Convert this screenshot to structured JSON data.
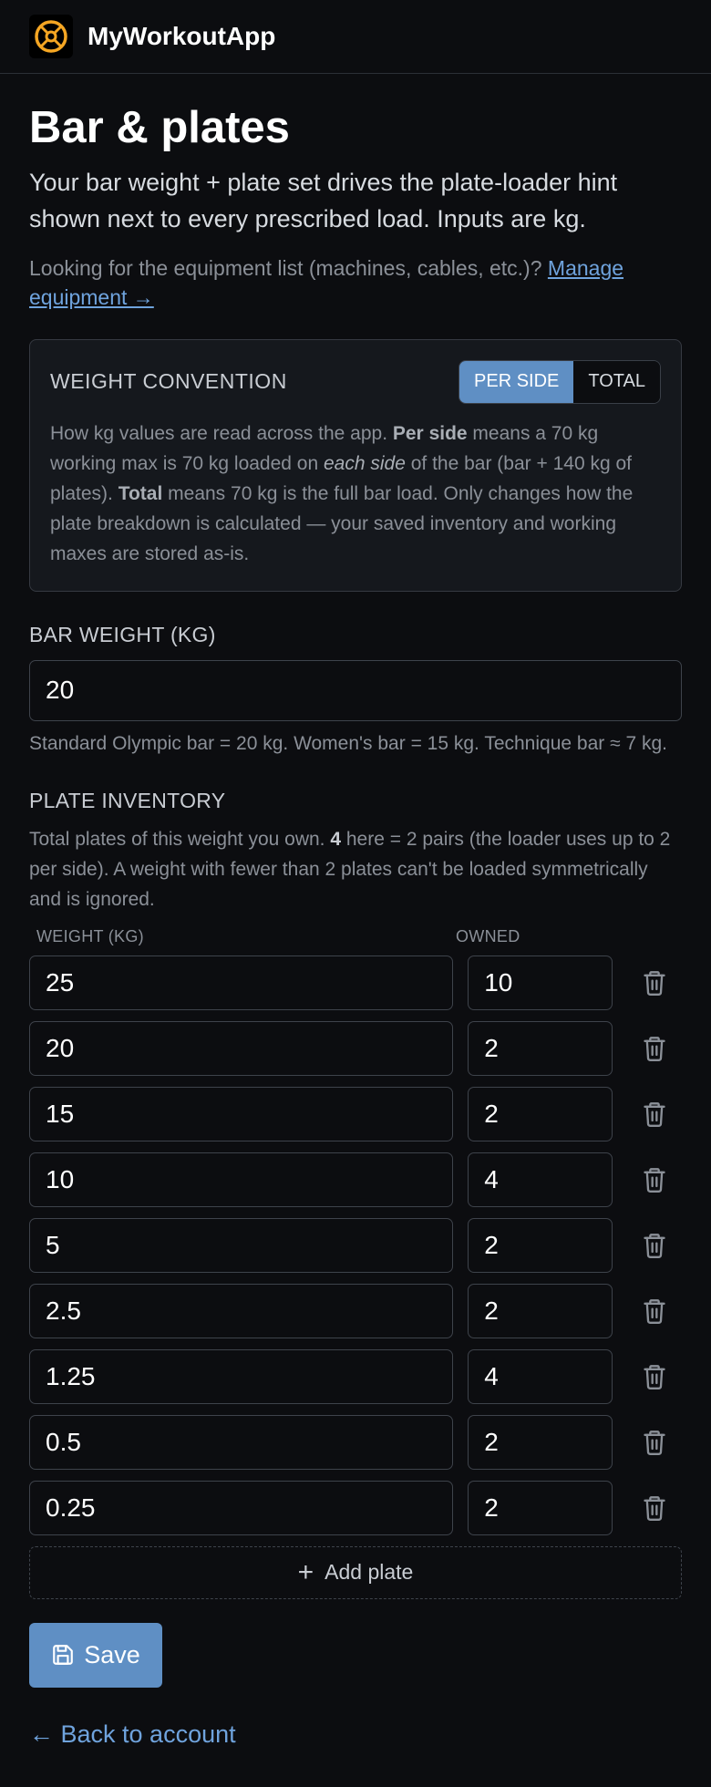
{
  "app": {
    "name": "MyWorkoutApp",
    "logo_icon": "plate-logo-icon",
    "accent": "#f5a623"
  },
  "page": {
    "title": "Bar & plates",
    "lead": "Your bar weight + plate set drives the plate-loader hint shown next to every prescribed load. Inputs are kg.",
    "equipment_hint": "Looking for the equipment list (machines, cables, etc.)?",
    "equipment_link": "Manage equipment →"
  },
  "convention": {
    "title": "WEIGHT CONVENTION",
    "options": [
      "PER SIDE",
      "TOTAL"
    ],
    "selected": "PER SIDE",
    "text_1": "How kg values are read across the app. ",
    "text_2": "Per side",
    "text_3": " means a 70 kg working max is 70 kg loaded on ",
    "text_4": "each side",
    "text_5": " of the bar (bar + 140 kg of plates). ",
    "text_6": "Total",
    "text_7": " means 70 kg is the full bar load. Only changes how the plate breakdown is calculated — your saved inventory and working maxes are stored as-is."
  },
  "bar": {
    "label": "BAR WEIGHT (KG)",
    "value": "20",
    "hint": "Standard Olympic bar = 20 kg. Women's bar = 15 kg. Technique bar ≈ 7 kg."
  },
  "inventory": {
    "label": "PLATE INVENTORY",
    "desc_1": "Total plates of this weight you own. ",
    "desc_2": "4",
    "desc_3": " here = 2 pairs (the loader uses up to 2 per side). A weight with fewer than 2 plates can't be loaded symmetrically and is ignored.",
    "col_weight": "WEIGHT (KG)",
    "col_owned": "OWNED",
    "plates": [
      {
        "weight": "25",
        "owned": "10"
      },
      {
        "weight": "20",
        "owned": "2"
      },
      {
        "weight": "15",
        "owned": "2"
      },
      {
        "weight": "10",
        "owned": "4"
      },
      {
        "weight": "5",
        "owned": "2"
      },
      {
        "weight": "2.5",
        "owned": "2"
      },
      {
        "weight": "1.25",
        "owned": "4"
      },
      {
        "weight": "0.5",
        "owned": "2"
      },
      {
        "weight": "0.25",
        "owned": "2"
      }
    ],
    "add_label": "Add plate",
    "add_icon": "plus-icon",
    "delete_icon": "trash-icon"
  },
  "actions": {
    "save_label": "Save",
    "save_icon": "floppy-disk-icon",
    "back_label": "← Back to account"
  }
}
